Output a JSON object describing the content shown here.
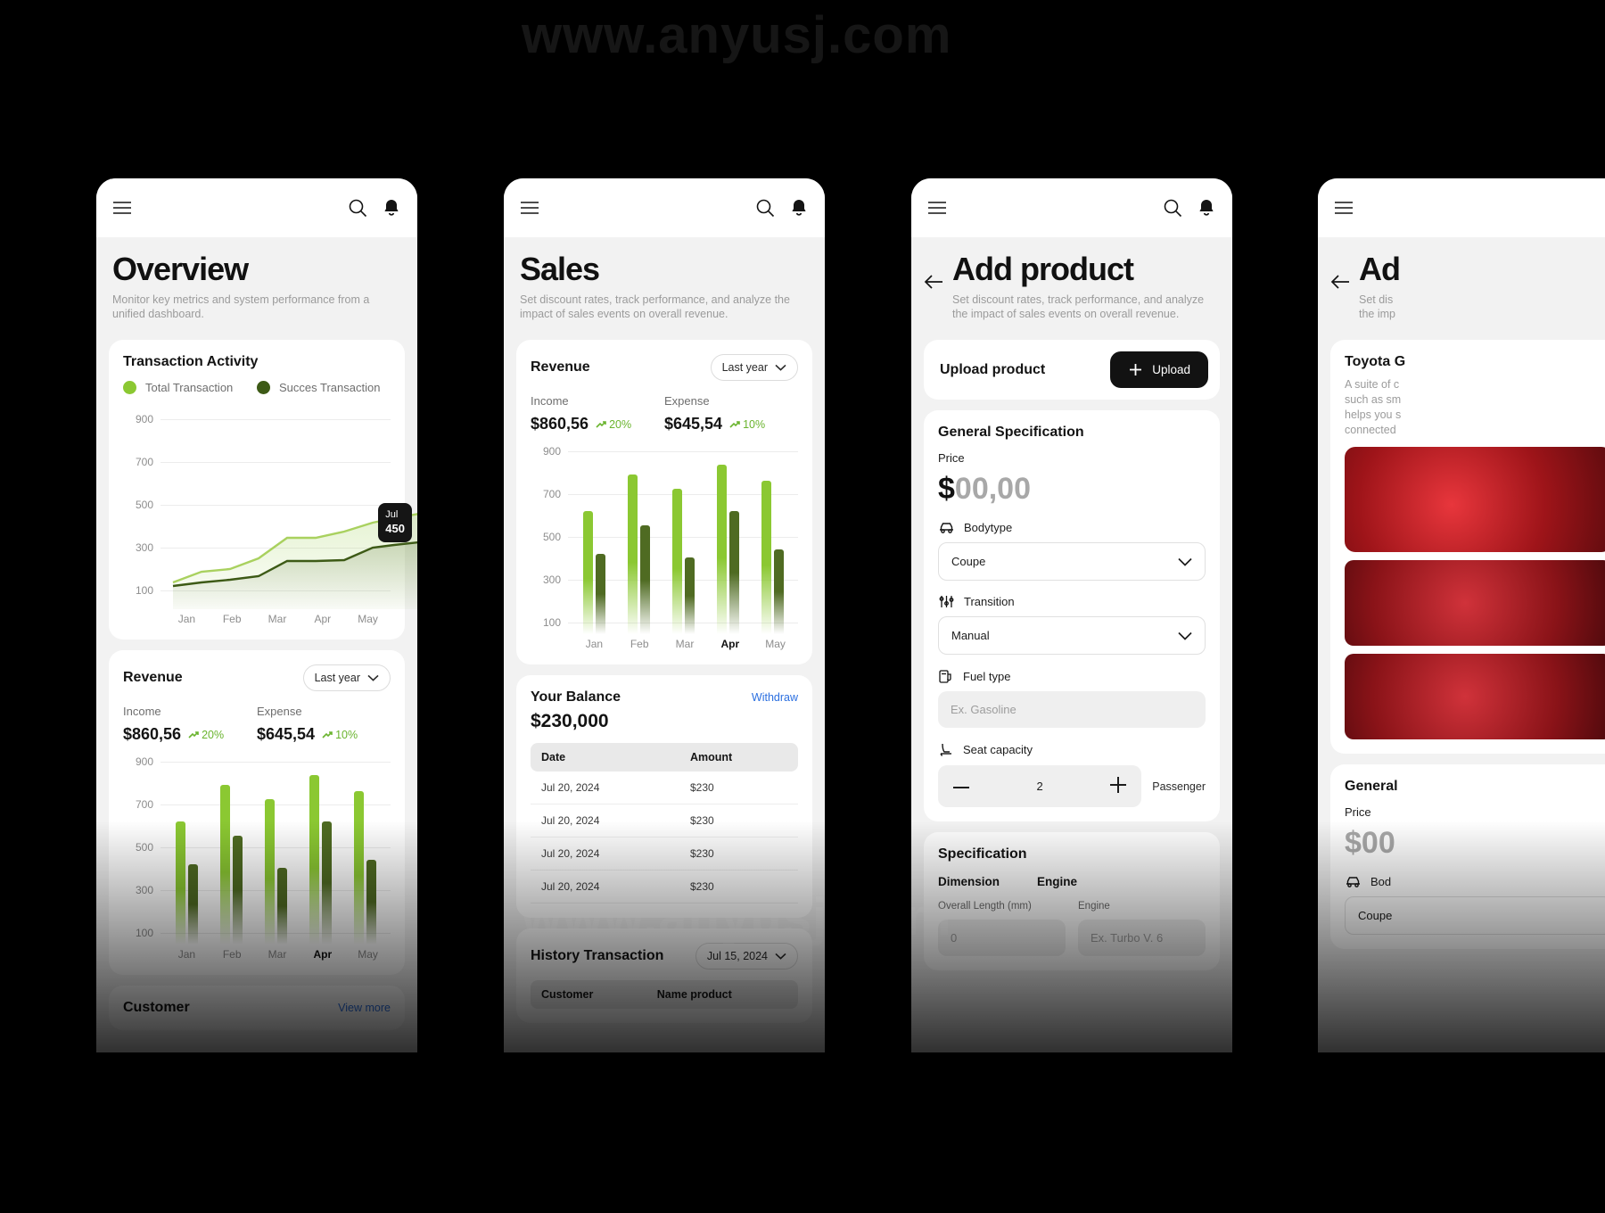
{
  "watermark": {
    "top": "www.anyusj.com",
    "middle": "www.anyusj.com"
  },
  "colors": {
    "accent_light": "#8BC832",
    "accent_dark": "#4F6B22",
    "positive": "#6ab42e",
    "link": "#2b6fe0",
    "dark": "#121212"
  },
  "phones": [
    {
      "id": "overview",
      "topbar": {
        "menu_icon": "hamburger-menu-icon",
        "search_icon": "search-icon",
        "bell_icon": "notification-bell-icon"
      },
      "title": "Overview",
      "subtitle": "Monitor key metrics and system performance from a unified dashboard.",
      "transaction_card": {
        "heading": "Transaction Activity",
        "legend": [
          {
            "label": "Total Transaction",
            "color": "#8BC832"
          },
          {
            "label": "Succes Transaction",
            "color": "#3D5A16"
          }
        ],
        "tooltip": {
          "label": "Jul",
          "value": "450"
        }
      },
      "revenue_card": {
        "heading": "Revenue",
        "period": "Last year",
        "income": {
          "label": "Income",
          "amount": "$860,56",
          "delta": "20%",
          "color": "#8BC832"
        },
        "expense": {
          "label": "Expense",
          "amount": "$645,54",
          "delta": "10%",
          "color": "#4F6B22"
        }
      },
      "customer_card": {
        "heading": "Customer",
        "view_more": "View more"
      }
    },
    {
      "id": "sales",
      "topbar": {
        "menu_icon": "hamburger-menu-icon",
        "search_icon": "search-icon",
        "bell_icon": "notification-bell-icon"
      },
      "title": "Sales",
      "subtitle": "Set discount rates, track performance, and analyze the impact of sales events on overall revenue.",
      "revenue_card": {
        "heading": "Revenue",
        "period": "Last year",
        "income": {
          "label": "Income",
          "amount": "$860,56",
          "delta": "20%",
          "color": "#8BC832"
        },
        "expense": {
          "label": "Expense",
          "amount": "$645,54",
          "delta": "10%",
          "color": "#4F6B22"
        }
      },
      "balance_card": {
        "heading": "Your Balance",
        "withdraw": "Withdraw",
        "amount": "$230,000",
        "columns": [
          "Date",
          "Amount"
        ],
        "rows": [
          {
            "date": "Jul 20, 2024",
            "amount": "$230"
          },
          {
            "date": "Jul 20, 2024",
            "amount": "$230"
          },
          {
            "date": "Jul 20, 2024",
            "amount": "$230"
          },
          {
            "date": "Jul 20, 2024",
            "amount": "$230"
          }
        ]
      },
      "history_card": {
        "heading": "History Transaction",
        "period": "Jul 15, 2024",
        "columns": [
          "Customer",
          "Name product"
        ]
      }
    },
    {
      "id": "add-product",
      "topbar": {
        "menu_icon": "hamburger-menu-icon",
        "search_icon": "search-icon",
        "bell_icon": "notification-bell-icon"
      },
      "back_icon": "arrow-left-icon",
      "title": "Add product",
      "subtitle": "Set discount rates, track performance, and analyze the impact of sales events on overall revenue.",
      "upload_card": {
        "label": "Upload product",
        "button": "Upload",
        "plus_icon": "plus-icon"
      },
      "general_card": {
        "heading": "General Specification",
        "price_label": "Price",
        "price_currency": "$",
        "price_value": "00,00",
        "bodytype": {
          "icon": "car-icon",
          "label": "Bodytype",
          "value": "Coupe"
        },
        "transition": {
          "icon": "sliders-icon",
          "label": "Transition",
          "value": "Manual"
        },
        "fuel": {
          "icon": "fuel-pump-icon",
          "label": "Fuel type",
          "placeholder": "Ex. Gasoline"
        },
        "seat": {
          "icon": "car-seat-icon",
          "label": "Seat capacity",
          "value": "2",
          "unit": "Passenger",
          "minus_icon": "minus-icon",
          "plus_icon": "plus-icon"
        }
      },
      "spec_card": {
        "heading": "Specification",
        "tabs": [
          "Dimension",
          "Engine"
        ],
        "fields": [
          {
            "label": "Overall Length (mm)",
            "value": "0"
          },
          {
            "label": "Engine",
            "placeholder": "Ex. Turbo V. 6"
          }
        ]
      }
    },
    {
      "id": "add-product-detail",
      "topbar": {
        "menu_icon": "hamburger-menu-icon"
      },
      "back_icon": "arrow-left-icon",
      "title": "Ad",
      "subtitle_lines": [
        "Set dis",
        "the imp"
      ],
      "product_card": {
        "heading": "Toyota G",
        "body_lines": [
          "A suite of c",
          "such as sm",
          "helps you s",
          "connected"
        ]
      },
      "general_card": {
        "heading": "General",
        "price_label": "Price",
        "price": "$00",
        "bodytype_label": "Bod",
        "bodytype_value": "Coupe"
      }
    }
  ],
  "chart_data": [
    {
      "type": "area",
      "title": "Transaction Activity",
      "categories": [
        "Jan",
        "Feb",
        "Mar",
        "Apr",
        "May"
      ],
      "yticks": [
        900,
        700,
        500,
        300,
        100
      ],
      "ylim": [
        0,
        1000
      ],
      "grid": true,
      "legend_position": "top",
      "series": [
        {
          "name": "Total Transaction",
          "color": "#8BC832",
          "values": [
            120,
            170,
            185,
            235,
            330,
            330,
            360,
            400,
            420,
            450
          ]
        },
        {
          "name": "Succes Transaction",
          "color": "#3D5A16",
          "values": [
            105,
            120,
            130,
            145,
            215,
            215,
            220,
            275,
            285,
            300
          ]
        }
      ],
      "annotation": {
        "label": "Jul",
        "value": "450"
      }
    },
    {
      "type": "bar",
      "title": "Revenue",
      "categories": [
        "Jan",
        "Feb",
        "Mar",
        "Apr",
        "May"
      ],
      "yticks": [
        900,
        700,
        500,
        300,
        100
      ],
      "ylim": [
        0,
        950
      ],
      "grid": true,
      "legend_position": "top",
      "series": [
        {
          "name": "Income",
          "color": "#8BC832",
          "values": [
            610,
            790,
            720,
            840,
            760
          ]
        },
        {
          "name": "Expense",
          "color": "#4F6B22",
          "values": [
            400,
            540,
            380,
            610,
            420
          ]
        }
      ]
    },
    {
      "type": "bar",
      "title": "Revenue",
      "categories": [
        "Jan",
        "Feb",
        "Mar",
        "Apr",
        "May"
      ],
      "yticks": [
        900,
        700,
        500,
        300,
        100
      ],
      "ylim": [
        0,
        950
      ],
      "grid": true,
      "legend_position": "top",
      "highlight_category": "Apr",
      "series": [
        {
          "name": "Income",
          "color": "#8BC832",
          "values": [
            610,
            790,
            720,
            840,
            760
          ]
        },
        {
          "name": "Expense",
          "color": "#4F6B22",
          "values": [
            400,
            540,
            380,
            610,
            420
          ]
        }
      ]
    }
  ]
}
